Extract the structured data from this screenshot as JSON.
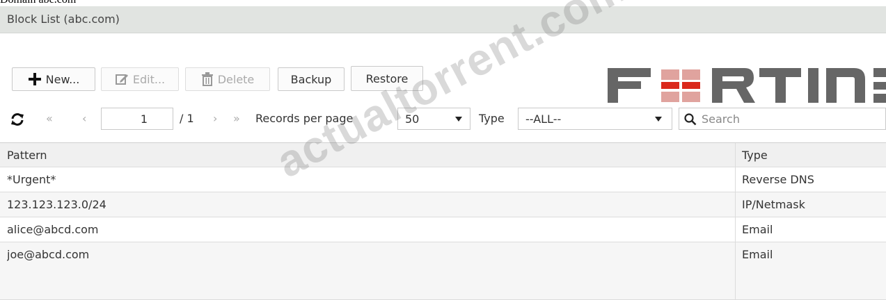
{
  "top_strip_text": "Domain abc.com",
  "window": {
    "title": "Block List (abc.com)"
  },
  "toolbar": {
    "new_label": "New...",
    "edit_label": "Edit...",
    "delete_label": "Delete",
    "backup_label": "Backup",
    "restore_label": "Restore"
  },
  "nav": {
    "first": "«",
    "prev": "‹",
    "page_value": "1",
    "page_total": "/ 1",
    "next": "›",
    "last": "»",
    "records_label": "Records per page",
    "records_value": "50",
    "type_label": "Type",
    "type_value": "--ALL--",
    "search_placeholder": "Search"
  },
  "brand": {
    "logo_text": "FORTINET",
    "accent_color": "#da291c"
  },
  "watermark": "actualtorrent.com",
  "table": {
    "columns": [
      "Pattern",
      "Type"
    ],
    "rows": [
      {
        "pattern": "*Urgent*",
        "type": "Reverse DNS"
      },
      {
        "pattern": "123.123.123.0/24",
        "type": "IP/Netmask"
      },
      {
        "pattern": "alice@abcd.com",
        "type": "Email"
      },
      {
        "pattern": "joe@abcd.com",
        "type": "Email"
      }
    ]
  }
}
